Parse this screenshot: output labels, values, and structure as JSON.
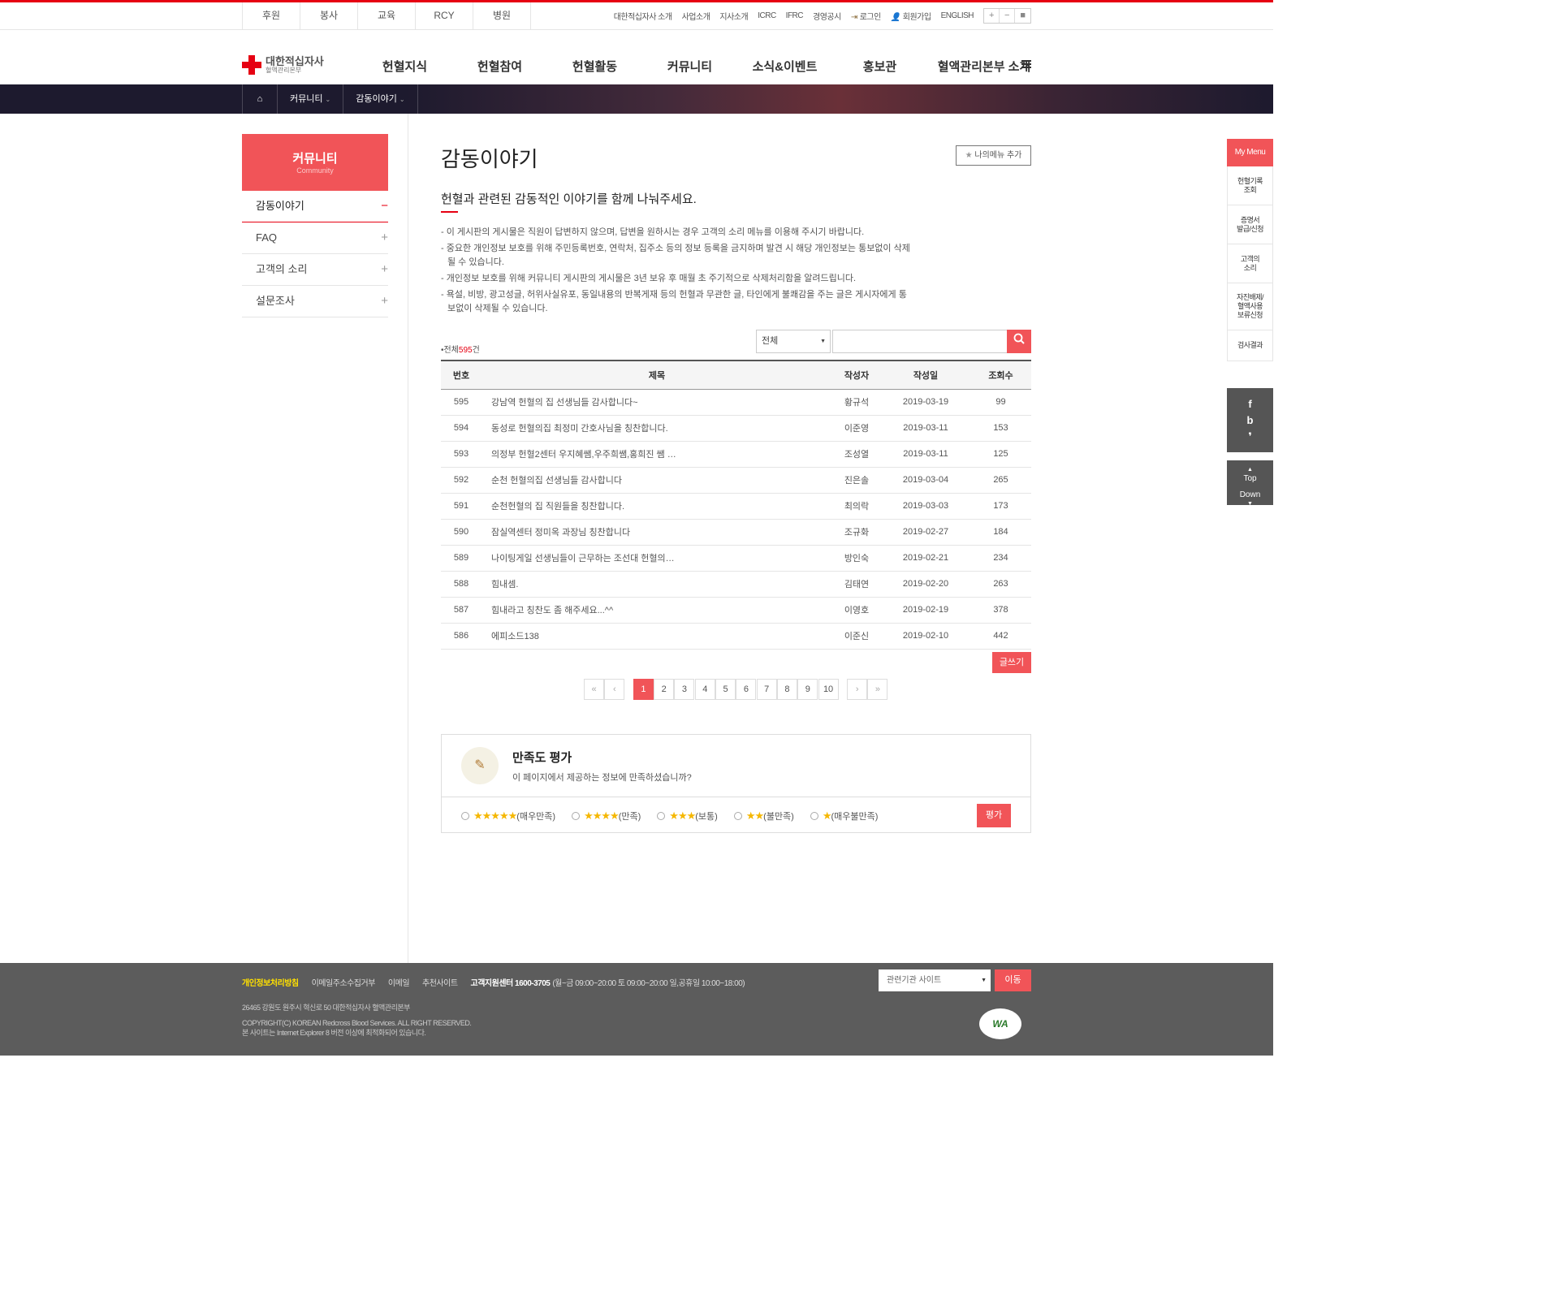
{
  "util_left": [
    "후원",
    "봉사",
    "교육",
    "RCY",
    "병원"
  ],
  "util_right": {
    "links": [
      "대한적십자사 소개",
      "사업소개",
      "지사소개",
      "ICRC",
      "IFRC",
      "경영공시"
    ],
    "login": "로그인",
    "join": "회원가입",
    "english": "ENGLISH",
    "zoom": [
      "+",
      "−",
      "■"
    ]
  },
  "logo": {
    "main": "대한적십자사",
    "sub": "혈액관리본부"
  },
  "gnb": [
    "헌혈지식",
    "헌혈참여",
    "헌혈활동",
    "커뮤니티",
    "소식&이벤트",
    "홍보관",
    "혈액관리본부 소개"
  ],
  "location": {
    "items": [
      "커뮤니티",
      "감동이야기"
    ]
  },
  "lnb": {
    "title": "커뮤니티",
    "subtitle": "Community",
    "items": [
      {
        "label": "감동이야기",
        "active": true
      },
      {
        "label": "FAQ",
        "active": false
      },
      {
        "label": "고객의 소리",
        "active": false
      },
      {
        "label": "설문조사",
        "active": false
      }
    ]
  },
  "page": {
    "title": "감동이야기",
    "add_menu": "나의메뉴 추가",
    "lead": "헌혈과 관련된 감동적인 이야기를 함께 나눠주세요.",
    "notices": [
      "- 이 게시판의 게시물은 직원이 답변하지 않으며, 답변을 원하시는 경우 고객의 소리 메뉴를 이용해 주시기 바랍니다.",
      "- 중요한 개인정보 보호를 위해 주민등록번호, 연락처, 집주소 등의 정보 등록을 금지하며 발견 시 해당 개인정보는 통보없이 삭제될 수 있습니다.",
      "- 개인정보 보호를 위해 커뮤니티 게시판의 게시물은 3년 보유 후 매월 초 주기적으로 삭제처리함을 알려드립니다.",
      "- 욕설, 비방, 광고성글, 허위사실유포, 동일내용의 반복게재 등의 헌혈과 무관한 글, 타인에게 불쾌감을 주는 글은 게시자에게 통보없이 삭제될 수 있습니다."
    ],
    "total_prefix": "•전체",
    "total_count": "595",
    "total_suffix": "건",
    "search_select": "전체",
    "write": "글쓰기"
  },
  "table": {
    "headers": [
      "번호",
      "제목",
      "작성자",
      "작성일",
      "조회수"
    ],
    "rows": [
      [
        "595",
        "강남역 헌혈의 집 선생님들 감사합니다~",
        "황규석",
        "2019-03-19",
        "99"
      ],
      [
        "594",
        "동성로 헌혈의집 최정미 간호사님을 칭찬합니다.",
        "이준영",
        "2019-03-11",
        "153"
      ],
      [
        "593",
        "의정부 헌혈2센터 우지혜쌤,우주희쌤,홍희진 쌤 …",
        "조성열",
        "2019-03-11",
        "125"
      ],
      [
        "592",
        "순천 헌혈의집 선생님들 감사합니다",
        "진은솔",
        "2019-03-04",
        "265"
      ],
      [
        "591",
        "순천헌혈의 집 직원들을 칭찬합니다.",
        "최의락",
        "2019-03-03",
        "173"
      ],
      [
        "590",
        "잠실역센터 정미옥 과장님 칭찬합니다",
        "조규화",
        "2019-02-27",
        "184"
      ],
      [
        "589",
        "나이팅게일 선생님들이 근무하는 조선대 헌혈의…",
        "방인숙",
        "2019-02-21",
        "234"
      ],
      [
        "588",
        "힘내셈.",
        "김태연",
        "2019-02-20",
        "263"
      ],
      [
        "587",
        "힘내라고 칭찬도 좀 해주세요...^^",
        "이영호",
        "2019-02-19",
        "378"
      ],
      [
        "586",
        "에피소드138",
        "이준신",
        "2019-02-10",
        "442"
      ]
    ]
  },
  "paging": {
    "first": "«",
    "prev": "‹",
    "pages": [
      "1",
      "2",
      "3",
      "4",
      "5",
      "6",
      "7",
      "8",
      "9",
      "10"
    ],
    "current": "1",
    "next": "›",
    "last": "»"
  },
  "survey": {
    "title": "만족도 평가",
    "desc": "이 페이지에서 제공하는 정보에 만족하셨습니까?",
    "options": [
      {
        "stars": "★★★★★",
        "label": "(매우만족)"
      },
      {
        "stars": "★★★★",
        "label": "(만족)"
      },
      {
        "stars": "★★★",
        "label": "(보통)"
      },
      {
        "stars": "★★",
        "label": "(불만족)"
      },
      {
        "stars": "★",
        "label": "(매우불만족)"
      }
    ],
    "submit": "평가"
  },
  "quick_menu": {
    "title": "My Menu",
    "items": [
      "헌혈기록\n조회",
      "증명서\n발급/신청",
      "고객의\n소리",
      "자진배제/\n혈액사용\n보류신청",
      "검사결과"
    ],
    "sns": [
      "f",
      "b",
      "❜"
    ],
    "top": "Top",
    "down": "Down"
  },
  "footer": {
    "links": [
      "개인정보처리방침",
      "이메일주소수집거부",
      "이메일",
      "추천사이트"
    ],
    "callcenter": "고객지원센터 1600-3705",
    "hours": "(월~금 09:00~20:00 토 09:00~20:00 일,공휴일 10:00~18:00)",
    "address": "26465 강원도 원주시 혁신로 50 대한적십자사 혈액관리본부",
    "copyright": "COPYRIGHT(C) KOREAN Redcross Blood Services. ALL RIGHT RESERVED.",
    "browser": "본 사이트는 Internet Explorer 8 버전 이상에 최적화되어 있습니다.",
    "related_select": "관련기관 사이트",
    "go": "이동",
    "badge": "WA"
  }
}
